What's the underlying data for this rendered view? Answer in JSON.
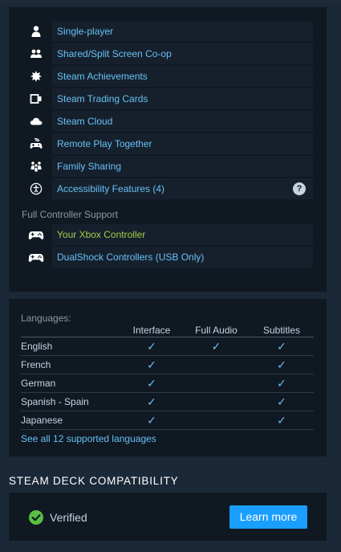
{
  "colors": {
    "accent": "#67c1f5",
    "background": "#1b2838",
    "panel": "#101822",
    "highlight": "#a1cd44",
    "button": "#1a9fff",
    "verified": "#59bf40"
  },
  "features": [
    {
      "label": "Single-player",
      "icon": "person-icon"
    },
    {
      "label": "Shared/Split Screen Co-op",
      "icon": "two-people-icon"
    },
    {
      "label": "Steam Achievements",
      "icon": "achievement-star-icon"
    },
    {
      "label": "Steam Trading Cards",
      "icon": "trading-cards-icon"
    },
    {
      "label": "Steam Cloud",
      "icon": "cloud-icon"
    },
    {
      "label": "Remote Play Together",
      "icon": "remote-play-icon"
    },
    {
      "label": "Family Sharing",
      "icon": "family-icon"
    },
    {
      "label": "Accessibility Features (4)",
      "icon": "accessibility-icon",
      "help": "?"
    }
  ],
  "controller_section": {
    "title": "Full Controller Support",
    "items": [
      {
        "label": "Your Xbox Controller",
        "icon": "gamepad-icon"
      },
      {
        "label": "DualShock Controllers (USB Only)",
        "icon": "gamepad-icon"
      }
    ]
  },
  "languages": {
    "heading": "Languages:",
    "columns": [
      "Interface",
      "Full Audio",
      "Subtitles"
    ],
    "check_glyph": "✓",
    "rows": [
      {
        "name": "English",
        "interface": true,
        "full_audio": true,
        "subtitles": true
      },
      {
        "name": "French",
        "interface": true,
        "full_audio": false,
        "subtitles": true
      },
      {
        "name": "German",
        "interface": true,
        "full_audio": false,
        "subtitles": true
      },
      {
        "name": "Spanish - Spain",
        "interface": true,
        "full_audio": false,
        "subtitles": true
      },
      {
        "name": "Japanese",
        "interface": true,
        "full_audio": false,
        "subtitles": true
      }
    ],
    "see_all": "See all 12 supported languages"
  },
  "steam_deck": {
    "title": "STEAM DECK COMPATIBILITY",
    "status": "Verified",
    "status_icon": "verified-check-icon",
    "learn_more": "Learn more"
  }
}
